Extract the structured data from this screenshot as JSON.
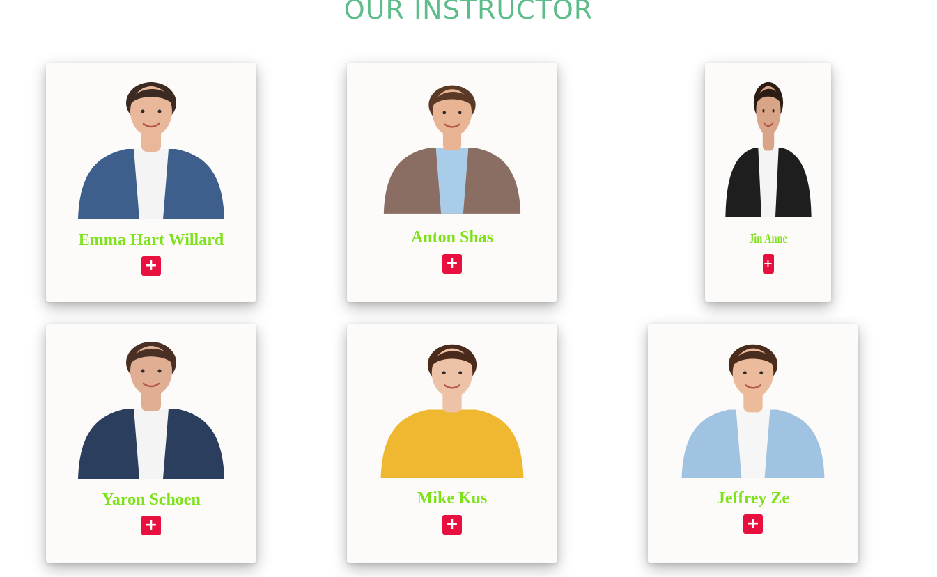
{
  "section": {
    "title": "OUR INSTRUCTOR"
  },
  "instructors": [
    {
      "name": "Emma Hart Willard",
      "action_label": "+",
      "palette": {
        "shirt": "#3e5f8c",
        "under": "#f4f4f4",
        "skin": "#e9b89a",
        "hair": "#3a2a22"
      }
    },
    {
      "name": "Anton Shas",
      "action_label": "+",
      "palette": {
        "shirt": "#8a6e63",
        "under": "#a9cde8",
        "skin": "#e8b493",
        "hair": "#5a3a26"
      }
    },
    {
      "name": "Jin Anne",
      "action_label": "+",
      "palette": {
        "shirt": "#1e1e1e",
        "under": "#f4f4f4",
        "skin": "#d9a588",
        "hair": "#2b1c14"
      }
    },
    {
      "name": "Yaron Schoen",
      "action_label": "+",
      "palette": {
        "shirt": "#2c3e5e",
        "under": "#f4f4f4",
        "skin": "#dfae93",
        "hair": "#4a3024"
      }
    },
    {
      "name": "Mike Kus",
      "action_label": "+",
      "palette": {
        "shirt": "#f0b731",
        "under": "#f0b731",
        "skin": "#eec2a6",
        "hair": "#4a2a1a"
      }
    },
    {
      "name": "Jeffrey Ze",
      "action_label": "+",
      "palette": {
        "shirt": "#9fc3e0",
        "under": "#f6f6f6",
        "skin": "#ebbb9c",
        "hair": "#4a2c1c"
      }
    }
  ]
}
